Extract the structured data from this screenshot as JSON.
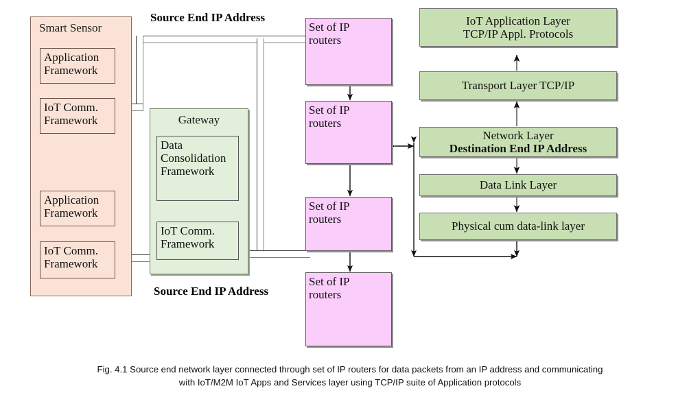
{
  "figure": {
    "caption_line1": "Fig. 4.1 Source end network layer connected through set of IP routers for data packets from an IP address and communicating",
    "caption_line2": "with IoT/M2M  IoT Apps and Services layer using TCP/IP suite of Application protocols"
  },
  "colors": {
    "sensor_fill": "#FAE3D6",
    "gateway_fill": "#E2EFDA",
    "router_fill": "#FBCDFB",
    "layer_fill": "#C8DFB3",
    "border": "#4a4a4a",
    "text": "#111111"
  },
  "smart_sensor": {
    "title": "Smart Sensor",
    "blocks": [
      {
        "label": "Application\nFramework"
      },
      {
        "label": "IoT Comm.\nFramework"
      },
      {
        "label": "Application\nFramework"
      },
      {
        "label": "IoT Comm.\nFramework"
      }
    ],
    "block_0_line1": "Application",
    "block_0_line2": "Framework",
    "block_1_line1": "IoT Comm.",
    "block_1_line2": "Framework",
    "block_2_line1": "Application",
    "block_2_line2": "Framework",
    "block_3_line1": "IoT Comm.",
    "block_3_line2": "Framework"
  },
  "gateway": {
    "title": "Gateway",
    "block_0_line1": "Data",
    "block_0_line2": "Consolidation",
    "block_0_line3": "Framework",
    "block_1_line1": "IoT Comm.",
    "block_1_line2": "Framework"
  },
  "labels": {
    "source_end_top": "Source End IP Address",
    "source_end_bottom": "Source End IP Address"
  },
  "routers": [
    {
      "line1": "Set of IP",
      "line2": "routers"
    },
    {
      "line1": "Set of IP",
      "line2": "routers"
    },
    {
      "line1": "Set of IP",
      "line2": "routers"
    },
    {
      "line1": "Set of IP",
      "line2": "routers"
    }
  ],
  "router_0_line1": "Set of IP",
  "router_0_line2": "routers",
  "router_1_line1": "Set of IP",
  "router_1_line2": "routers",
  "router_2_line1": "Set of IP",
  "router_2_line2": "routers",
  "router_3_line1": "Set of IP",
  "router_3_line2": "routers",
  "protocol_stack": {
    "layers": [
      {
        "line1": "IoT Application Layer",
        "line2": "TCP/IP Appl. Protocols",
        "bold_line2": false
      },
      {
        "line1": "Transport Layer TCP/IP",
        "line2": "",
        "bold_line2": false
      },
      {
        "line1": "Network Layer",
        "line2": "Destination End IP Address",
        "bold_line2": true
      },
      {
        "line1": "Data Link Layer",
        "line2": "",
        "bold_line2": false
      },
      {
        "line1": "Physical cum data-link layer",
        "line2": "",
        "bold_line2": false
      }
    ],
    "layer_0_line1": "IoT Application Layer",
    "layer_0_line2": "TCP/IP Appl. Protocols",
    "layer_1_line1": "Transport Layer TCP/IP",
    "layer_2_line1": "Network Layer",
    "layer_2_line2": "Destination End IP Address",
    "layer_3_line1": "Data Link Layer",
    "layer_4_line1": "Physical cum data-link layer"
  }
}
